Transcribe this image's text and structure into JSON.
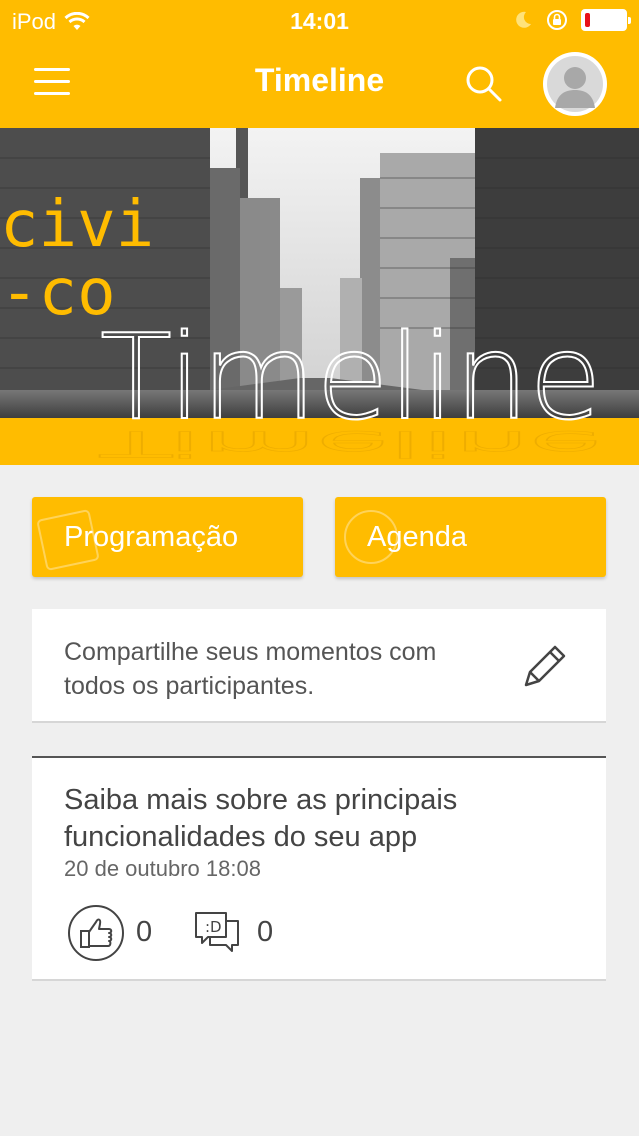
{
  "status_bar": {
    "carrier": "iPod",
    "time": "14:01",
    "battery_level": 0.12,
    "battery_color": "#e8121a"
  },
  "header": {
    "title": "Timeline",
    "menu_icon": "hamburger-icon",
    "search_icon": "search-icon",
    "avatar_icon": "user-avatar-icon"
  },
  "banner": {
    "logo_line1": "civi",
    "logo_line2": "-co",
    "overlay_title": "Timeline"
  },
  "actions": {
    "programacao_label": "Programação",
    "agenda_label": "Agenda"
  },
  "share": {
    "prompt": "Compartilhe seus momentos com todos os participantes.",
    "icon": "pencil-icon"
  },
  "post": {
    "title": "Saiba mais sobre as principais funcionalidades do seu app",
    "date": "20 de outubro 18:08",
    "likes": "0",
    "comments": "0"
  },
  "colors": {
    "brand": "#ffbc00",
    "background": "#efefef"
  }
}
